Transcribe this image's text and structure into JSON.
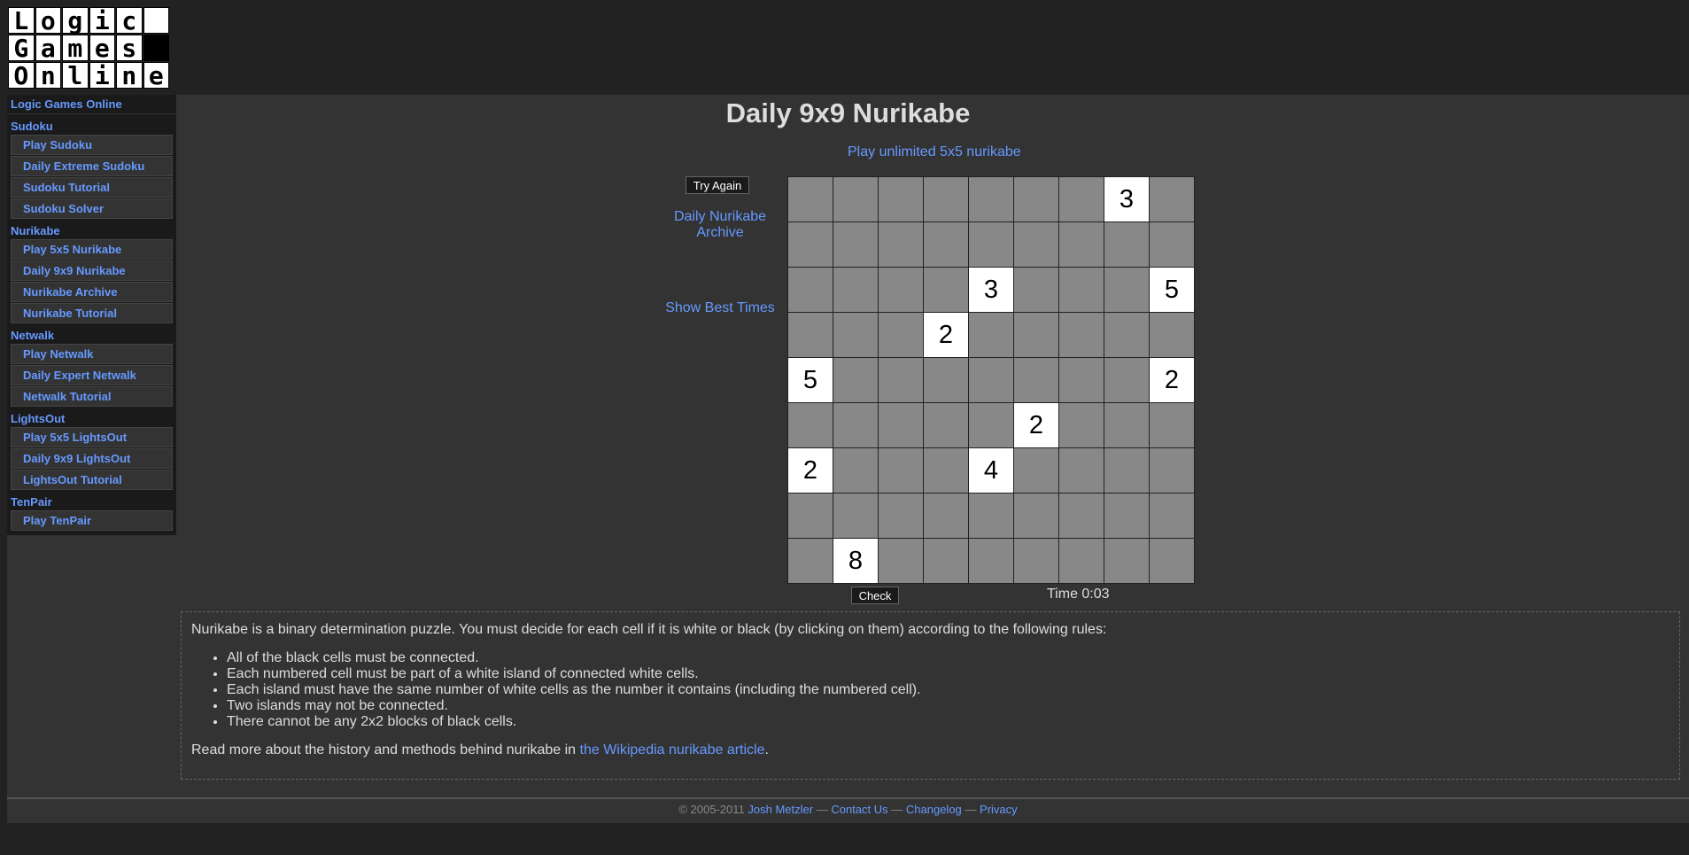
{
  "logo": {
    "rows": [
      [
        "L",
        "o",
        "g",
        "i",
        "c",
        ""
      ],
      [
        "G",
        "a",
        "m",
        "e",
        "s",
        ""
      ],
      [
        "O",
        "n",
        "l",
        "i",
        "n",
        "e"
      ]
    ],
    "black_cells": [
      [
        1,
        5
      ]
    ]
  },
  "sidebar": {
    "top_link": "Logic Games Online",
    "groups": [
      {
        "head": "Sudoku",
        "items": [
          "Play Sudoku",
          "Daily Extreme Sudoku",
          "Sudoku Tutorial",
          "Sudoku Solver"
        ]
      },
      {
        "head": "Nurikabe",
        "items": [
          "Play 5x5 Nurikabe",
          "Daily 9x9 Nurikabe",
          "Nurikabe Archive",
          "Nurikabe Tutorial"
        ]
      },
      {
        "head": "Netwalk",
        "items": [
          "Play Netwalk",
          "Daily Expert Netwalk",
          "Netwalk Tutorial"
        ]
      },
      {
        "head": "LightsOut",
        "items": [
          "Play 5x5 LightsOut",
          "Daily 9x9 LightsOut",
          "LightsOut Tutorial"
        ]
      },
      {
        "head": "TenPair",
        "items": [
          "Play TenPair"
        ]
      }
    ]
  },
  "page": {
    "title": "Daily 9x9 Nurikabe",
    "unlimited_link": "Play unlimited 5x5 nurikabe",
    "try_again": "Try Again",
    "archive_link": "Daily Nurikabe Archive",
    "best_times": "Show Best Times",
    "check": "Check",
    "timer": "Time 0:03"
  },
  "board": {
    "size": 9,
    "clues": [
      {
        "r": 0,
        "c": 7,
        "v": "3"
      },
      {
        "r": 2,
        "c": 4,
        "v": "3"
      },
      {
        "r": 2,
        "c": 8,
        "v": "5"
      },
      {
        "r": 3,
        "c": 3,
        "v": "2"
      },
      {
        "r": 4,
        "c": 0,
        "v": "5"
      },
      {
        "r": 4,
        "c": 8,
        "v": "2"
      },
      {
        "r": 5,
        "c": 5,
        "v": "2"
      },
      {
        "r": 6,
        "c": 0,
        "v": "2"
      },
      {
        "r": 6,
        "c": 4,
        "v": "4"
      },
      {
        "r": 8,
        "c": 1,
        "v": "8"
      }
    ]
  },
  "rules": {
    "intro": "Nurikabe is a binary determination puzzle. You must decide for each cell if it is white or black (by clicking on them) according to the following rules:",
    "items": [
      "All of the black cells must be connected.",
      "Each numbered cell must be part of a white island of connected white cells.",
      "Each island must have the same number of white cells as the number it contains (including the numbered cell).",
      "Two islands may not be connected.",
      "There cannot be any 2x2 blocks of black cells."
    ],
    "outro_before": "Read more about the history and methods behind nurikabe in ",
    "outro_link": "the Wikipedia nurikabe article",
    "outro_after": "."
  },
  "footer": {
    "copyright": "© 2005-2011",
    "author": "Josh Metzler",
    "sep1": "—",
    "contact": "Contact Us",
    "sep2": "—",
    "changelog": "Changelog",
    "sep3": "—",
    "privacy": "Privacy"
  },
  "colors": {
    "link": "#6699ff",
    "board_cell": "#888888",
    "page_bg": "#222222",
    "content_bg": "#333333"
  }
}
